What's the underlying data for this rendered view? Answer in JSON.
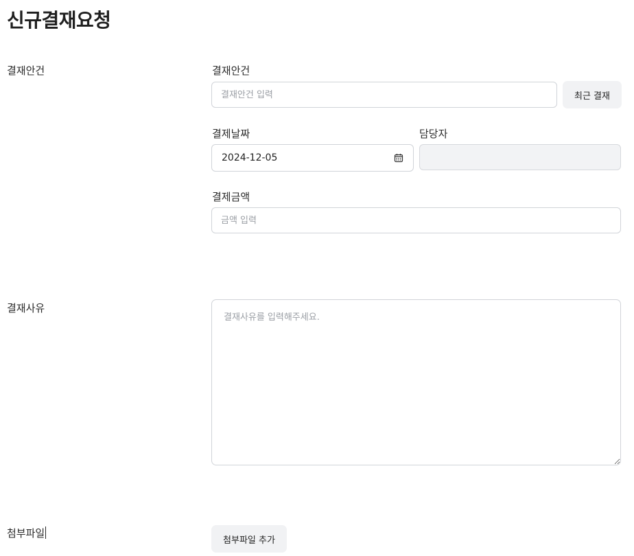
{
  "page": {
    "title": "신규결재요청"
  },
  "sections": {
    "case": {
      "label": "결재안건"
    },
    "reason": {
      "label": "결재사유"
    },
    "attachment": {
      "label": "첨부파일"
    }
  },
  "form": {
    "case_title": {
      "label": "결재안건",
      "placeholder": "결재안건 입력"
    },
    "recent_button": {
      "label": "최근 결재"
    },
    "date": {
      "label": "결제날짜",
      "value": "2024-12-05",
      "icon": "calendar-icon"
    },
    "manager": {
      "label": "담당자",
      "value": ""
    },
    "amount": {
      "label": "결제금액",
      "placeholder": "금액 입력"
    },
    "reason": {
      "placeholder": "결재사유를 입력해주세요."
    },
    "attach_button": {
      "label": "첨부파일 추가"
    }
  }
}
